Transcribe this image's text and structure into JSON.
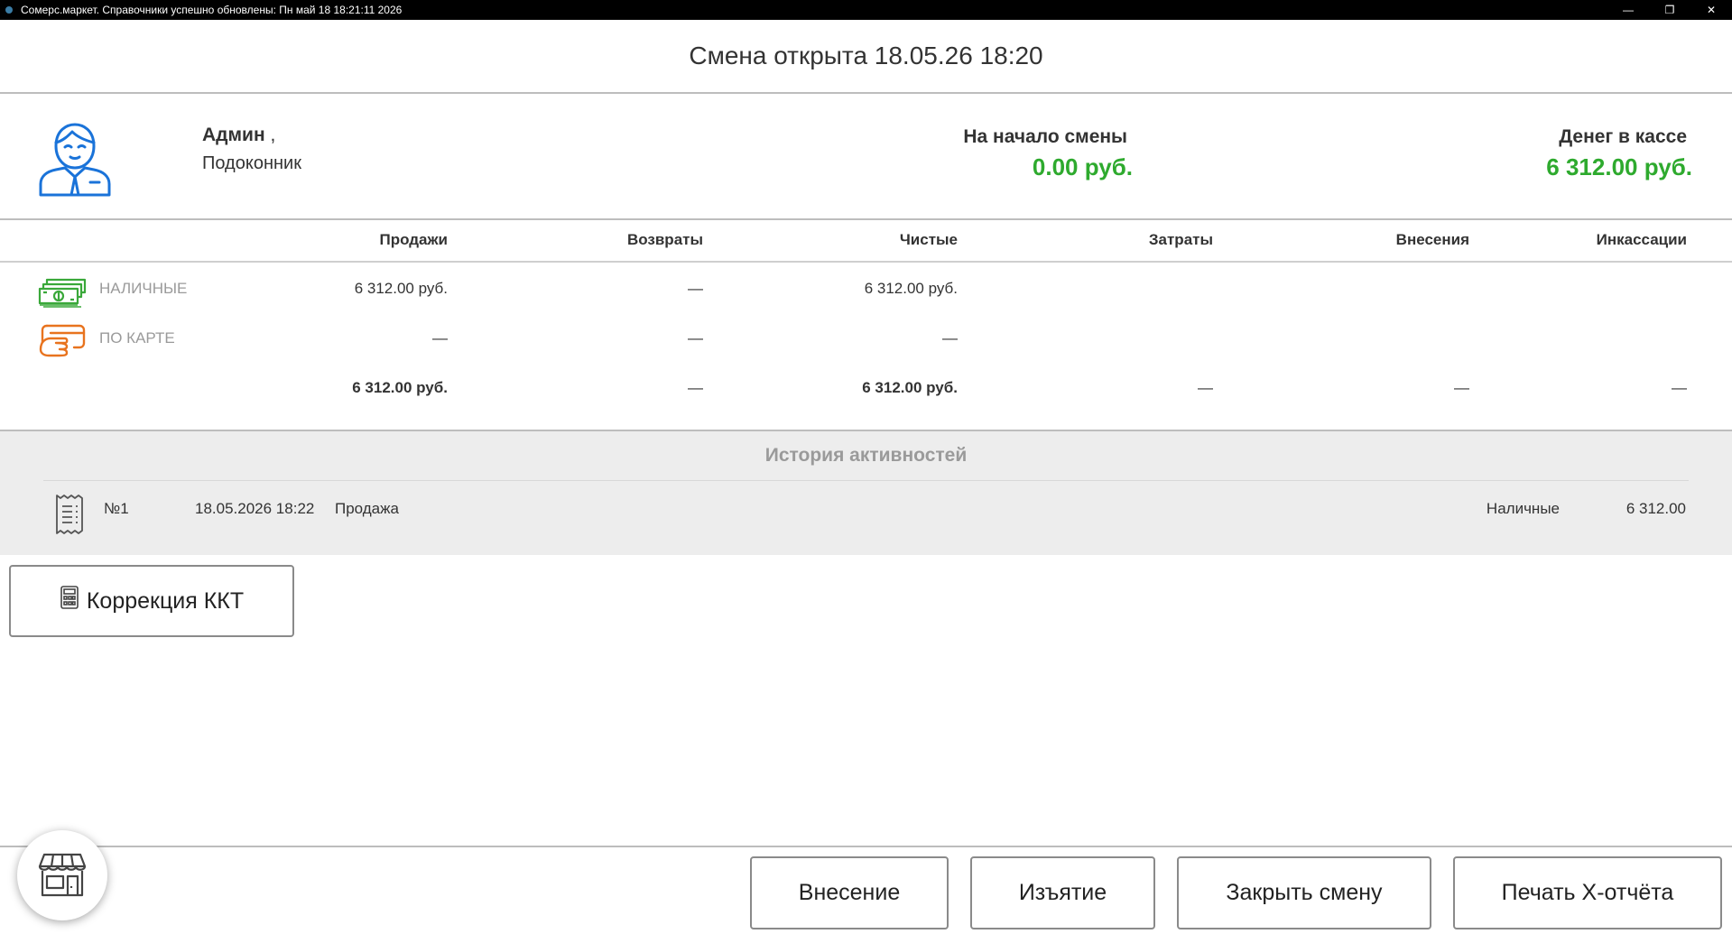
{
  "window": {
    "title": "Сомерс.маркет. Справочники успешно обновлены: Пн май 18 18:21:11 2026",
    "minimize_glyph": "—",
    "restore_glyph": "❐",
    "close_glyph": "✕"
  },
  "header": {
    "shift_title": "Смена открыта 18.05.26 18:20"
  },
  "user": {
    "name": "Админ",
    "name_suffix": " ,",
    "shop": "Подоконник"
  },
  "totals": {
    "start_label": "На начало смены",
    "start_value": "0.00 руб.",
    "cash_label": "Денег в кассе",
    "cash_value": "6 312.00 руб."
  },
  "payments": {
    "columns": [
      "Продажи",
      "Возвраты",
      "Чистые",
      "Затраты",
      "Внесения",
      "Инкассации"
    ],
    "rows": [
      {
        "type": "НАЛИЧНЫЕ",
        "icon": "cash-icon",
        "sales": "6 312.00 руб.",
        "returns": "—",
        "net": "6 312.00 руб."
      },
      {
        "type": "ПО КАРТЕ",
        "icon": "card-icon",
        "sales": "—",
        "returns": "—",
        "net": "—"
      }
    ],
    "total": {
      "sales": "6 312.00 руб.",
      "returns": "—",
      "net": "6 312.00 руб.",
      "costs": "—",
      "deposits": "—",
      "collections": "—"
    }
  },
  "history": {
    "title": "История активностей",
    "items": [
      {
        "number": "№1",
        "datetime": "18.05.2026 18:22",
        "operation": "Продажа",
        "payment": "Наличные",
        "amount": "6 312.00",
        "icon": "receipt-icon"
      }
    ]
  },
  "buttons": {
    "kkt_correction": "Коррекция ККТ",
    "deposit": "Внесение",
    "withdraw": "Изъятие",
    "close_shift": "Закрыть смену",
    "x_report": "Печать X-отчёта"
  },
  "colors": {
    "accent_green": "#2eaa2e",
    "user_icon_blue": "#1a73d9",
    "cash_icon_green": "#3aa83a",
    "card_icon_orange": "#e8731e"
  }
}
